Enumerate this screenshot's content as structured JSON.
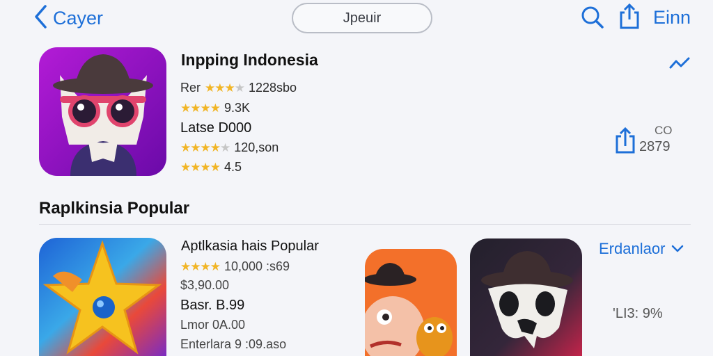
{
  "nav": {
    "back_label": "Cayer",
    "search_text": "Jpeuir",
    "right_label": "Einn"
  },
  "featured": {
    "title": "Inpping Indonesia",
    "lines": [
      {
        "prefix": "Rer",
        "stars": 3.5,
        "text": "1228sbo"
      },
      {
        "prefix": "",
        "stars": 4,
        "text": "9.3K"
      },
      {
        "prefix": "",
        "stars": null,
        "text": "Latse D000"
      },
      {
        "prefix": "",
        "stars": 4,
        "text": "120,son"
      },
      {
        "prefix": "",
        "stars": 4,
        "text": "4.5"
      }
    ],
    "side_small": "CO",
    "side_count": "2879"
  },
  "section": {
    "title": "Raplkinsia Popular"
  },
  "popular": {
    "title": "Aptlkasia hais Popular",
    "lines": [
      {
        "stars": 4,
        "text": "10,000 :s69"
      },
      {
        "stars": null,
        "text": "$3,90.00"
      },
      {
        "stars": null,
        "text": "Basr. B.99"
      },
      {
        "stars": null,
        "text": "Lmor 0A.00"
      },
      {
        "stars": null,
        "text": "Enterlara 9 :09.aso"
      }
    ],
    "dropdown_label": "Erdanlaor",
    "percent": "'LI3: 9%"
  },
  "colors": {
    "accent": "#1d6fd8",
    "star": "#f1b526"
  }
}
